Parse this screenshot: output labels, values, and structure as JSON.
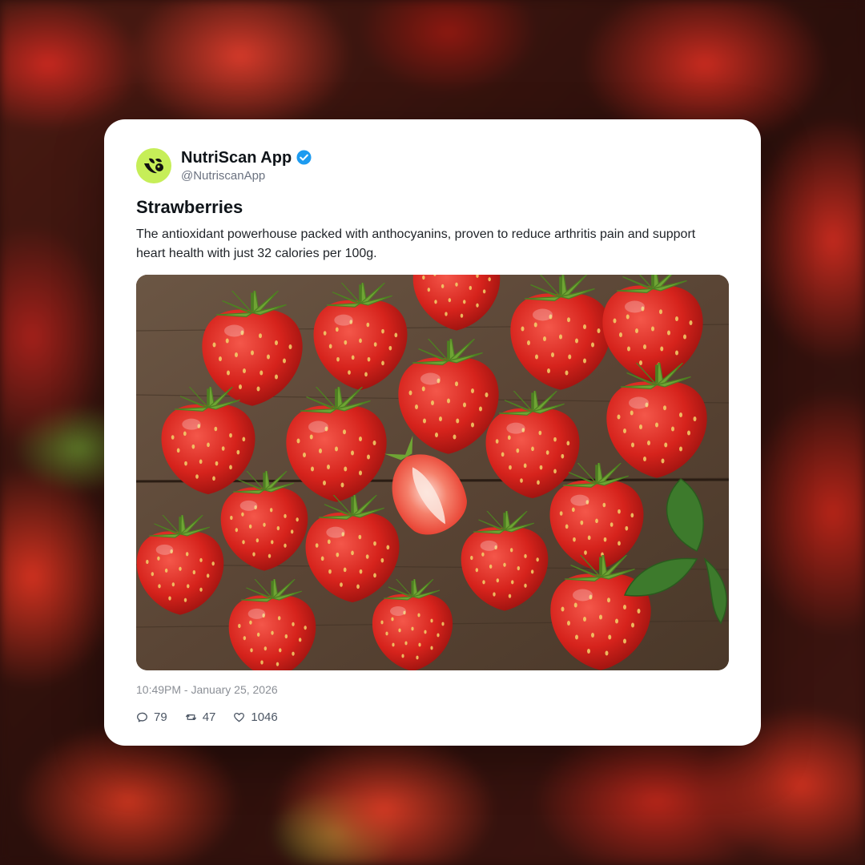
{
  "post": {
    "display_name": "NutriScan App",
    "handle": "@NutriscanApp",
    "verified": true,
    "title": "Strawberries",
    "body": "The antioxidant powerhouse packed with anthocyanins, proven to reduce arthritis pain and support heart health with just 32 calories per 100g.",
    "timestamp": "10:49PM - January 25, 2026",
    "image_subject": "strawberries-on-wooden-table"
  },
  "actions": {
    "replies": "79",
    "retweets": "47",
    "likes": "1046"
  },
  "colors": {
    "avatar_bg": "#c6ee58",
    "verified_blue": "#1d9bf0",
    "card_bg": "#ffffff",
    "text_primary": "#0f1419",
    "text_muted": "#8b8f96"
  },
  "icons": [
    "nutriscan-logo-icon",
    "verified-badge-icon",
    "reply-icon",
    "retweet-icon",
    "like-icon"
  ]
}
